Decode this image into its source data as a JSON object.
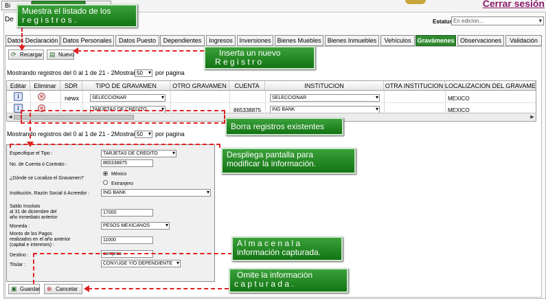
{
  "top_tabs": [
    "Bi",
    "",
    ""
  ],
  "cerrar_sesion": "Cerrar sesión",
  "declarante_label": "De",
  "estatus": {
    "label": "Estatus",
    "value": "En edicion..."
  },
  "section_tabs": [
    "Datos Declaración",
    "Datos Personales",
    "Datos Puesto",
    "Dependientes",
    "Ingresos",
    "Inversiones",
    "Bienes Muebles",
    "Bienes Inmuebles",
    "Vehículos",
    "Gravámenes",
    "Observaciones",
    "Validación"
  ],
  "toolbar": {
    "reload": "Recargar",
    "new": "Nuevo"
  },
  "pager": {
    "text": "Mostrando registros del 0 al 1 de 21 - 2Mostrando",
    "per_page_value": "50",
    "per_page_suffix": "por pagina"
  },
  "grid": {
    "headers": [
      "Editar",
      "Eliminar",
      "SDR",
      "TIPO DE GRAVAMEN",
      "OTRO GRAVAMEN",
      "CUENTA",
      "INSTITUCION",
      "OTRA INSTITUCION",
      "LOCALIZACION DEL GRAVAMEN"
    ],
    "rows": [
      {
        "sdr": "newx",
        "tipo": "SELECCIONAR",
        "otro": "",
        "cuenta": "",
        "institucion": "SELECCIONAR",
        "otra_inst": "",
        "localizacion": "MEXICO"
      },
      {
        "sdr": "",
        "tipo": "TARJETAS DE CREDITO",
        "otro": "",
        "cuenta": "865338875",
        "institucion": "ING BANK",
        "otra_inst": "",
        "localizacion": "MEXICO"
      }
    ]
  },
  "form": {
    "tipo_label": "Especifique el Tipo :",
    "tipo_value": "TARJETAS DE CREDITO",
    "cuenta_label": "No. de Cuenta ó Contrato :",
    "cuenta_value": "865338875",
    "localiza_label": "¿Dónde se Localiza el Gravamen?",
    "radio_mexico": "México",
    "radio_extranjero": "Extranjero",
    "institucion_label": "Institución, Razón Social ó Acreedor :",
    "institucion_value": "ING BANK",
    "saldo_label_1": "Saldo Insoluto",
    "saldo_label_2": "al 31 de diciembre del",
    "saldo_label_3": "año inmediato anterior",
    "saldo_value": "17000",
    "moneda_label": "Moneda :",
    "moneda_value": "PESOS MEXICANOS",
    "pagos_label_1": "Monto de los Pagos",
    "pagos_label_2": "realizados en el año anterior",
    "pagos_label_3": "(capital e intereses) :",
    "pagos_value": "11000",
    "destino_label": "Destino :",
    "destino_value": "compras",
    "titular_label": "Titular :",
    "titular_value": "CONYUGE Y/O DEPENDIENTE",
    "save": "Guardar",
    "cancel": "Cancelar"
  },
  "callouts": {
    "listado_1": "Muestra el listado de los",
    "listado_2": "r e g i s t r o s .",
    "inserta_1": "Inserta un nuevo",
    "inserta_2": "R e g i s t r o",
    "borra": "Borra registros existentes",
    "despliega_1": "Despliega pantalla para",
    "despliega_2": "modificar la información.",
    "almacena_1": "A l m a c e n a l a",
    "almacena_2": "información capturada.",
    "omite_1": "Omite la información",
    "omite_2": "c a p t u r a d a ."
  }
}
